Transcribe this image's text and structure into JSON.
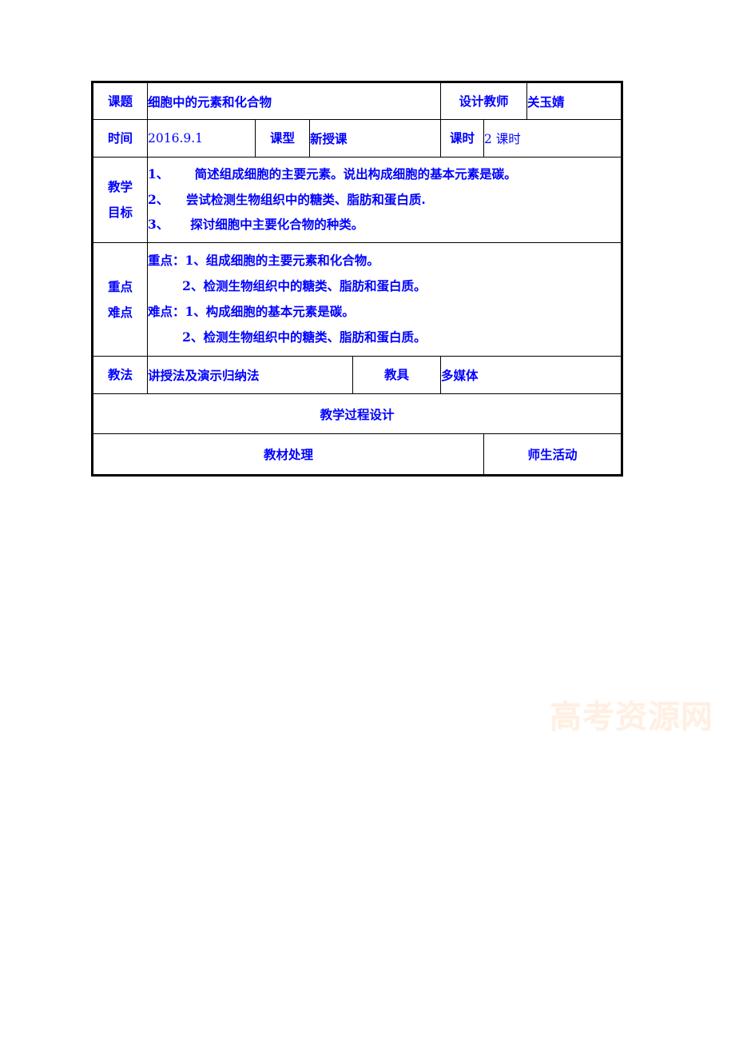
{
  "document": {
    "type": "lesson-plan-table",
    "text_color": "#0000ff",
    "border_color": "#000000",
    "background": "#ffffff"
  },
  "table": {
    "row_title": {
      "label": "课题",
      "value": "细胞中的元素和化合物",
      "teacher_label": "设计教师",
      "teacher_value": "关玉婧"
    },
    "row_meta": {
      "time_label": "时间",
      "time_value": "2016.9.1",
      "type_label": "课型",
      "type_value": "新授课",
      "periods_label": "课时",
      "periods_value": "2 课时"
    },
    "row_objectives": {
      "label_line1": "教学",
      "label_line2": "目标",
      "items": [
        "1、      简述组成细胞的主要元素。说出构成细胞的基本元素是碳。",
        "2、    尝试检测生物组织中的糖类、脂肪和蛋白质.",
        "3、     探讨细胞中主要化合物的种类。"
      ]
    },
    "row_keypoints": {
      "label_line1": "重点",
      "label_line2": "难点",
      "items": [
        "重点：1、组成细胞的主要元素和化合物。",
        "        2、检测生物组织中的糖类、脂肪和蛋白质。",
        "难点：1、构成细胞的基本元素是碳。",
        "        2、检测生物组织中的糖类、脂肪和蛋白质。"
      ]
    },
    "row_methods": {
      "method_label": "教法",
      "method_value": "讲授法及演示归纳法",
      "tools_label": "教具",
      "tools_value": "多媒体"
    },
    "row_process": {
      "title": "教学过程设计"
    },
    "row_columns": {
      "left": "教材处理",
      "right": "师生活动"
    }
  },
  "watermark": {
    "text": "高考资源网",
    "color": "#ffd9e4"
  }
}
